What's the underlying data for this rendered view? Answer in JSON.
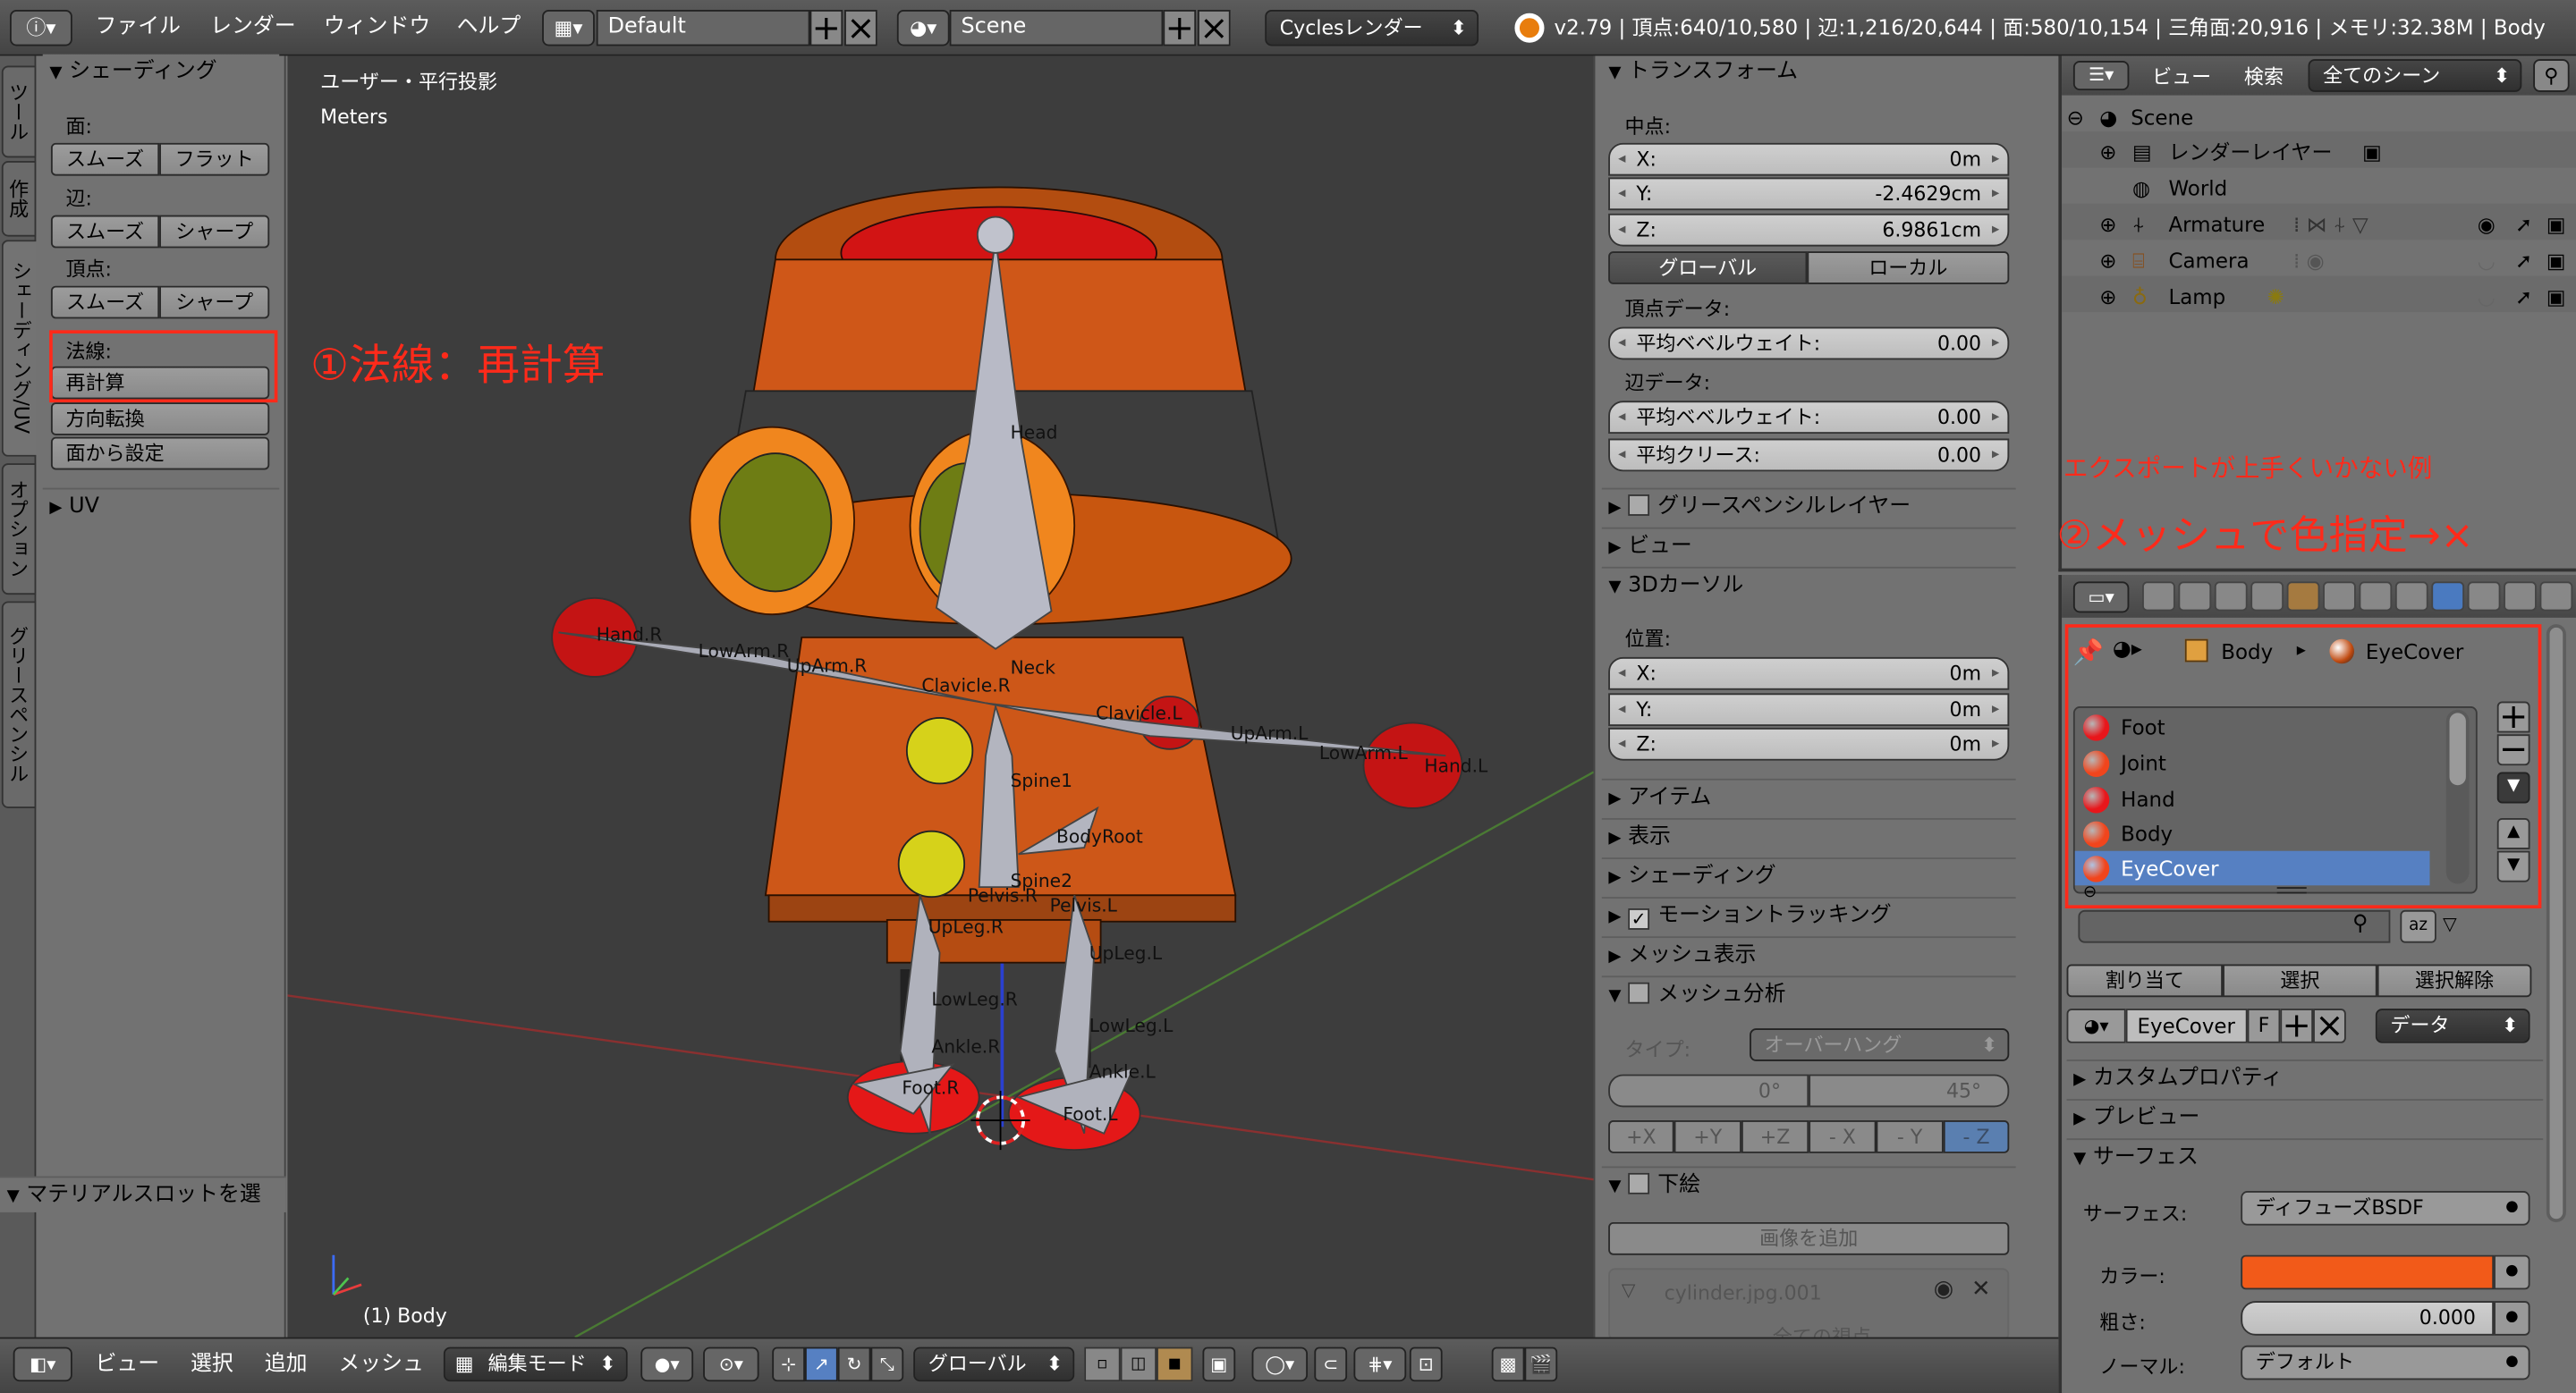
{
  "topbar": {
    "menus": [
      "ファイル",
      "レンダー",
      "ウィンドウ",
      "ヘルプ"
    ],
    "layout": "Default",
    "scene": "Scene",
    "engine": "Cyclesレンダー",
    "stats": "v2.79 | 頂点:640/10,580 | 辺:1,216/20,644 | 面:580/10,154 | 三角面:20,916 | メモリ:32.38M | Body"
  },
  "left_tabs": [
    "ツール",
    "作成",
    "シェーディング/UV",
    "オプション",
    "グリースペンシル"
  ],
  "tool_panel": {
    "title": "シェーディング",
    "face_label": "面:",
    "edge_label": "辺:",
    "vertex_label": "頂点:",
    "smooth": "スムーズ",
    "flat": "フラット",
    "sharp": "シャープ",
    "normals_label": "法線:",
    "recalc": "再計算",
    "flip": "方向転換",
    "set_from_faces": "面から設定",
    "uv": "UV",
    "bottom_panel": "マテリアルスロットを選"
  },
  "viewport": {
    "view_name": "ユーザー・平行投影",
    "units": "Meters",
    "object_label": "(1) Body",
    "bones": [
      "Head",
      "Neck",
      "Clavicle.R",
      "Clavicle.L",
      "UpArm.R",
      "LowArm.R",
      "Hand.R",
      "UpArm.L",
      "LowArm.L",
      "Hand.L",
      "Spine1",
      "Spine2",
      "BodyRoot",
      "Pelvis.R",
      "Pelvis.L",
      "UpLeg.R",
      "UpLeg.L",
      "LowLeg.R",
      "LowLeg.L",
      "Ankle.R",
      "Ankle.L",
      "Foot.R",
      "Foot.L"
    ],
    "annotation1": "①法線：再計算"
  },
  "props": {
    "transform": "トランスフォーム",
    "median": "中点:",
    "x": "X:",
    "x_val": "0m",
    "y": "Y:",
    "y_val": "-2.4629cm",
    "z": "Z:",
    "z_val": "6.9861cm",
    "global": "グローバル",
    "local": "ローカル",
    "vertex_data": "頂点データ:",
    "mean_bevel": "平均ベベルウェイト:",
    "mean_bevel_val": "0.00",
    "edge_data": "辺データ:",
    "edge_bevel": "平均ベベルウェイト:",
    "edge_bevel_val": "0.00",
    "crease": "平均クリース:",
    "crease_val": "0.00",
    "grease_layer": "グリースペンシルレイヤー",
    "view": "ビュー",
    "cursor3d": "3Dカーソル",
    "location": "位置:",
    "cx": "X:",
    "cx_val": "0m",
    "cy": "Y:",
    "cy_val": "0m",
    "cz": "Z:",
    "cz_val": "0m",
    "item": "アイテム",
    "display": "表示",
    "shading": "シェーディング",
    "motion": "モーショントラッキング",
    "mesh_display": "メッシュ表示",
    "mesh_analysis": "メッシュ分析",
    "type_label": "タイプ:",
    "type_val": "オーバーハング",
    "deg_min": "0°",
    "deg_max": "45°",
    "axes": [
      "+X",
      "+Y",
      "+Z",
      "- X",
      "- Y",
      "- Z"
    ],
    "background": "下絵",
    "add_image": "画像を追加",
    "image_name": "cylinder.jpg.001",
    "view_all": "全ての視点"
  },
  "outliner": {
    "view": "ビュー",
    "search": "検索",
    "scope": "全てのシーン",
    "items": [
      "Scene",
      "レンダーレイヤー",
      "World",
      "Armature",
      "Camera",
      "Lamp"
    ]
  },
  "material": {
    "annotation_a": "エクスポートが上手くいかない例",
    "annotation_b": "②メッシュで色指定→×",
    "crumb_obj": "Body",
    "crumb_mat": "EyeCover",
    "slots": [
      {
        "name": "Foot",
        "color": "#e8161b"
      },
      {
        "name": "Joint",
        "color": "#f1451c"
      },
      {
        "name": "Hand",
        "color": "#e8161b"
      },
      {
        "name": "Body",
        "color": "#f1451c"
      },
      {
        "name": "EyeCover",
        "color": "#f1451c"
      }
    ],
    "assign": "割り当て",
    "select": "選択",
    "deselect": "選択解除",
    "mat_name": "EyeCover",
    "fake": "F",
    "data": "データ",
    "custom_props": "カスタムプロパティ",
    "preview": "プレビュー",
    "surface": "サーフェス",
    "surface_label": "サーフェス:",
    "surface_val": "ディフューズBSDF",
    "color_label": "カラー:",
    "color_val": "#f25a19",
    "rough_label": "粗さ:",
    "rough_val": "0.000",
    "normal_label": "ノーマル:",
    "normal_val": "デフォルト"
  },
  "bottombar": {
    "menus": [
      "ビュー",
      "選択",
      "追加",
      "メッシュ"
    ],
    "mode": "編集モード",
    "orientation": "グローバル"
  }
}
